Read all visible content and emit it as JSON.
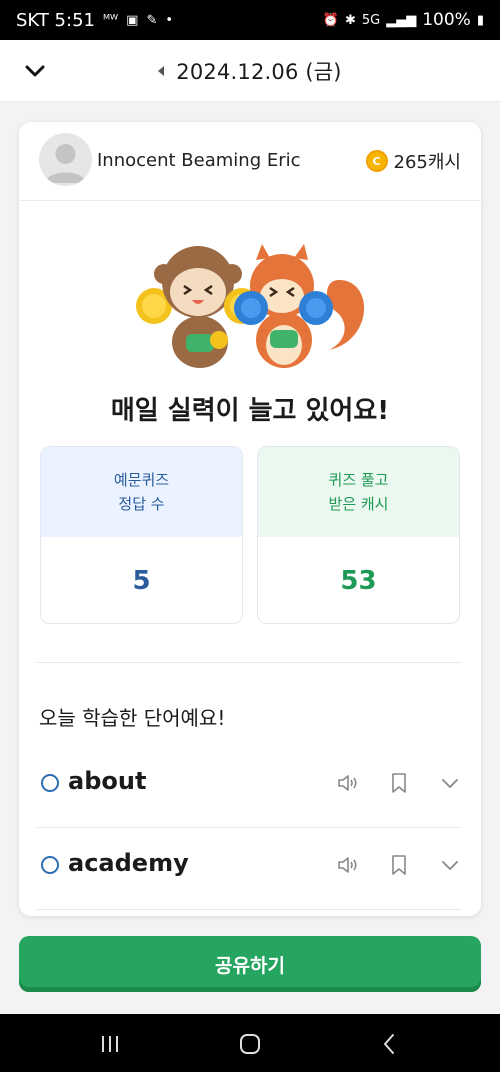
{
  "status_bar": {
    "carrier_time": "SKT 5:51",
    "battery": "100%",
    "left_icons": [
      "nfc-icon",
      "screenshot-icon",
      "app-icon",
      "dot-icon"
    ],
    "right_icons": [
      "alarm-icon",
      "bluetooth-icon",
      "5g-icon",
      "signal-icon",
      "battery-icon"
    ]
  },
  "nav": {
    "date": "2024.12.06 (금)",
    "back_icon": "chevron-down-icon",
    "prev_icon": "triangle-left-icon"
  },
  "card": {
    "username": "Innocent Beaming Eric",
    "cash": "265캐시",
    "headline": "매일 실력이 늘고 있어요!",
    "stats": [
      {
        "label_line1": "예문퀴즈",
        "label_line2": "정답 수",
        "value": "5",
        "color": "#2a5c9c"
      },
      {
        "label_line1": "퀴즈 풀고",
        "label_line2": "받은 캐시",
        "value": "53",
        "color": "#1f9a56"
      }
    ],
    "section_title": "오늘 학습한 단어예요!",
    "words": [
      {
        "word": "about"
      },
      {
        "word": "academy"
      }
    ]
  },
  "share_button": {
    "label": "공유하기",
    "color": "#25a55f"
  },
  "android_nav": {
    "icons": [
      "recents-icon",
      "home-icon",
      "back-icon"
    ]
  }
}
